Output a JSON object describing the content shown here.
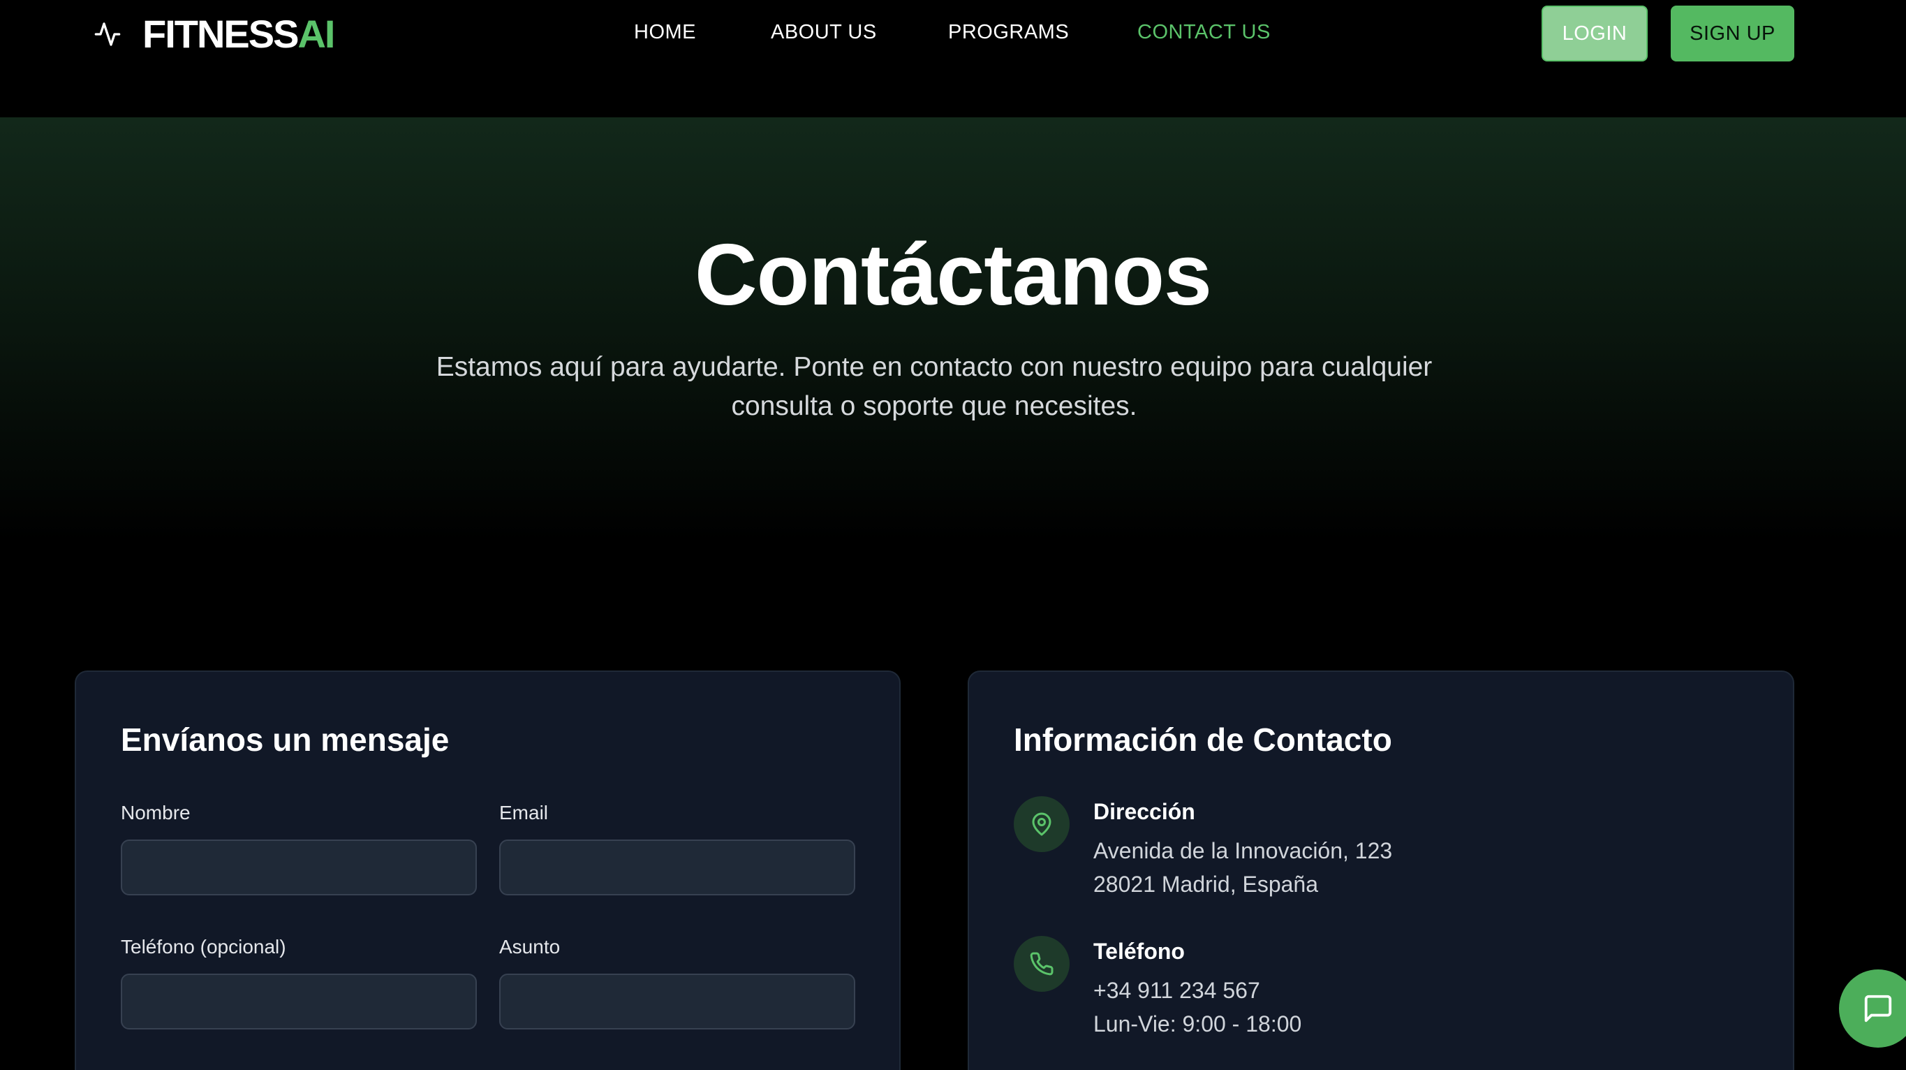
{
  "header": {
    "logo_fitness": "FITNESS",
    "logo_ai": "AI",
    "nav": [
      {
        "label": "HOME"
      },
      {
        "label": "ABOUT US"
      },
      {
        "label": "PROGRAMS"
      },
      {
        "label": "CONTACT US",
        "active": true
      }
    ],
    "login_label": "LOGIN",
    "signup_label": "SIGN UP"
  },
  "hero": {
    "title": "Contáctanos",
    "subtitle": "Estamos aquí para ayudarte. Ponte en contacto con nuestro equipo para cualquier consulta o soporte que necesites."
  },
  "form": {
    "title": "Envíanos un mensaje",
    "fields": [
      {
        "label": "Nombre",
        "value": "",
        "placeholder": ""
      },
      {
        "label": "Email",
        "value": "",
        "placeholder": ""
      },
      {
        "label": "Teléfono (opcional)",
        "value": "",
        "placeholder": ""
      },
      {
        "label": "Asunto",
        "value": "",
        "placeholder": ""
      }
    ]
  },
  "contact_info": {
    "title": "Información de Contacto",
    "items": [
      {
        "title": "Dirección",
        "icon": "map-pin-icon",
        "lines": [
          "Avenida de la Innovación, 123",
          "28021 Madrid, España"
        ]
      },
      {
        "title": "Teléfono",
        "icon": "phone-icon",
        "lines": [
          "+34 911 234 567",
          "Lun-Vie: 9:00 - 18:00"
        ]
      }
    ]
  },
  "colors": {
    "accent": "#5bc36a",
    "card_bg": "#111827",
    "input_bg": "#1f2937",
    "icon_bg": "#1e3a2a"
  }
}
